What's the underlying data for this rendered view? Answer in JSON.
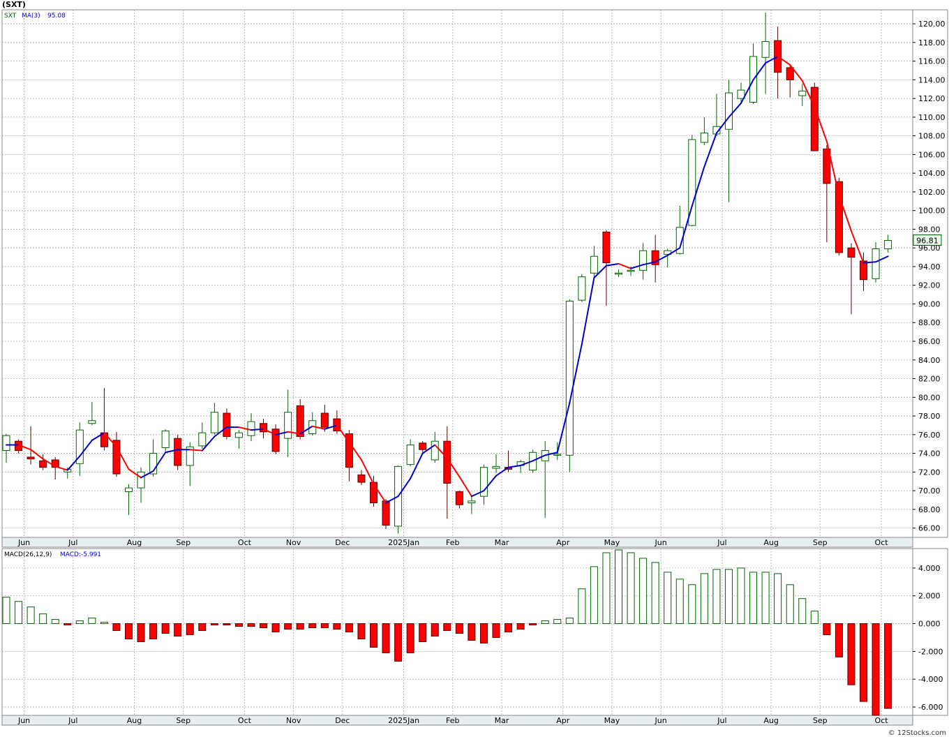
{
  "title": "(SXT)",
  "credit": "© 12Stocks.com",
  "colors": {
    "up": "#006400",
    "down": "#ff0000",
    "ma_up": "#0000cc",
    "ma_down": "#ff0000",
    "grid": "#aaaaaa",
    "axis_bg": "#e6eef2"
  },
  "price_panel": {
    "legend_symbol": "SXT",
    "legend_ma": "MA(3)",
    "legend_ma_value": "95.08",
    "last_price_label": "96.81"
  },
  "macd_panel": {
    "legend_name": "MACD(26,12,9)",
    "legend_value": "MACD:-5.991"
  },
  "month_labels": [
    {
      "label": "Jun",
      "i": 1
    },
    {
      "label": "Jul",
      "i": 5
    },
    {
      "label": "Aug",
      "i": 10
    },
    {
      "label": "Sep",
      "i": 14
    },
    {
      "label": "Oct",
      "i": 19
    },
    {
      "label": "Nov",
      "i": 23
    },
    {
      "label": "Dec",
      "i": 27
    },
    {
      "label": "2025Jan",
      "i": 32
    },
    {
      "label": "Feb",
      "i": 36
    },
    {
      "label": "Mar",
      "i": 40
    },
    {
      "label": "Apr",
      "i": 45
    },
    {
      "label": "May",
      "i": 49
    },
    {
      "label": "Jun",
      "i": 53
    },
    {
      "label": "Jul",
      "i": 58
    },
    {
      "label": "Aug",
      "i": 62
    },
    {
      "label": "Sep",
      "i": 66
    },
    {
      "label": "Oct",
      "i": 71
    }
  ],
  "chart_data": [
    {
      "type": "candlestick",
      "title": "(SXT)",
      "ylim": [
        65,
        121.5
      ],
      "yticks": [
        "66.00",
        "68.00",
        "70.00",
        "72.00",
        "74.00",
        "76.00",
        "78.00",
        "80.00",
        "82.00",
        "84.00",
        "86.00",
        "88.00",
        "90.00",
        "92.00",
        "94.00",
        "96.00",
        "98.00",
        "100.00",
        "102.00",
        "104.00",
        "106.00",
        "108.00",
        "110.00",
        "112.00",
        "114.00",
        "116.00",
        "118.00",
        "120.00"
      ],
      "candles": [
        [
          74.3,
          75.9,
          73.0,
          76.1
        ],
        [
          75.3,
          74.3,
          74.0,
          75.5
        ],
        [
          73.6,
          73.4,
          72.8,
          76.9
        ],
        [
          73.2,
          72.5,
          72.2,
          73.9
        ],
        [
          73.3,
          72.5,
          71.2,
          73.6
        ],
        [
          72.0,
          72.3,
          71.3,
          72.5
        ],
        [
          72.9,
          76.5,
          71.6,
          77.3
        ],
        [
          77.2,
          77.5,
          77.0,
          79.5
        ],
        [
          76.2,
          74.7,
          74.3,
          81.0
        ],
        [
          75.4,
          71.8,
          71.5,
          76.3
        ],
        [
          69.9,
          70.3,
          67.4,
          70.7
        ],
        [
          70.3,
          72.0,
          68.7,
          72.5
        ],
        [
          71.8,
          74.0,
          71.5,
          75.5
        ],
        [
          74.6,
          76.4,
          74.2,
          76.6
        ],
        [
          75.6,
          72.7,
          72.2,
          76.0
        ],
        [
          72.7,
          74.7,
          70.5,
          75.2
        ],
        [
          74.8,
          76.2,
          74.5,
          77.3
        ],
        [
          76.2,
          78.4,
          76.0,
          79.4
        ],
        [
          78.3,
          75.8,
          75.5,
          78.8
        ],
        [
          75.7,
          76.2,
          74.5,
          76.5
        ],
        [
          75.9,
          77.4,
          75.3,
          78.3
        ],
        [
          77.2,
          76.3,
          75.6,
          77.7
        ],
        [
          76.6,
          74.2,
          73.9,
          77.1
        ],
        [
          75.6,
          78.4,
          73.6,
          80.8
        ],
        [
          79.1,
          75.8,
          75.5,
          79.8
        ],
        [
          76.1,
          77.5,
          75.9,
          78.4
        ],
        [
          78.3,
          76.8,
          76.3,
          79.2
        ],
        [
          77.7,
          76.4,
          76.1,
          78.6
        ],
        [
          76.1,
          72.5,
          71.0,
          76.5
        ],
        [
          71.7,
          70.9,
          70.6,
          72.2
        ],
        [
          70.9,
          68.7,
          68.3,
          71.6
        ],
        [
          68.9,
          66.3,
          65.9,
          69.1
        ],
        [
          66.2,
          72.6,
          65.4,
          72.7
        ],
        [
          72.8,
          74.9,
          72.6,
          75.5
        ],
        [
          75.1,
          74.4,
          74.0,
          75.3
        ],
        [
          73.3,
          75.3,
          73.0,
          76.3
        ],
        [
          75.3,
          70.8,
          67.0,
          76.9
        ],
        [
          69.9,
          68.5,
          68.1,
          70.0
        ],
        [
          68.7,
          68.9,
          67.5,
          69.4
        ],
        [
          69.4,
          72.5,
          68.5,
          72.8
        ],
        [
          72.4,
          72.6,
          71.9,
          73.9
        ],
        [
          72.5,
          72.3,
          72.0,
          74.3
        ],
        [
          72.7,
          73.1,
          71.9,
          73.3
        ],
        [
          72.2,
          74.1,
          71.9,
          74.4
        ],
        [
          73.2,
          74.3,
          67.1,
          75.3
        ],
        [
          73.9,
          73.9,
          73.3,
          75.2
        ],
        [
          73.8,
          90.3,
          72.0,
          90.5
        ],
        [
          90.4,
          92.9,
          90.2,
          93.2
        ],
        [
          93.3,
          95.1,
          92.9,
          96.2
        ],
        [
          97.7,
          94.4,
          89.8,
          97.9
        ],
        [
          93.2,
          93.3,
          92.9,
          93.7
        ],
        [
          93.5,
          93.6,
          93.0,
          94.0
        ],
        [
          93.6,
          95.7,
          92.6,
          96.5
        ],
        [
          95.7,
          94.2,
          92.3,
          97.4
        ],
        [
          95.3,
          95.7,
          93.9,
          95.9
        ],
        [
          95.4,
          98.2,
          95.3,
          100.5
        ],
        [
          98.4,
          107.6,
          98.3,
          108.1
        ],
        [
          107.3,
          108.3,
          107.0,
          110.0
        ],
        [
          108.2,
          109.0,
          108.0,
          112.5
        ],
        [
          108.7,
          112.6,
          100.9,
          114.0
        ],
        [
          112.0,
          112.9,
          111.6,
          113.7
        ],
        [
          111.6,
          116.5,
          111.4,
          117.9
        ],
        [
          116.4,
          118.1,
          112.5,
          121.2
        ],
        [
          118.2,
          114.8,
          112.0,
          119.7
        ],
        [
          115.3,
          114.0,
          112.1,
          115.6
        ],
        [
          112.3,
          112.8,
          111.2,
          113.6
        ],
        [
          113.2,
          106.4,
          106.4,
          113.7
        ],
        [
          106.6,
          102.9,
          96.6,
          107.0
        ],
        [
          103.1,
          95.5,
          95.2,
          103.5
        ],
        [
          96.0,
          95.0,
          88.9,
          96.5
        ],
        [
          94.6,
          92.6,
          91.4,
          95.5
        ],
        [
          92.7,
          95.9,
          92.3,
          96.6
        ],
        [
          95.9,
          96.8,
          95.5,
          97.4
        ]
      ],
      "ma": [
        74.9,
        74.9,
        74.4,
        73.4,
        72.6,
        72.2,
        73.7,
        75.4,
        76.2,
        74.7,
        72.3,
        71.4,
        72.1,
        74.1,
        74.4,
        74.4,
        74.3,
        75.8,
        76.8,
        76.8,
        76.5,
        76.6,
        76.0,
        76.3,
        76.1,
        76.9,
        76.6,
        77.0,
        75.2,
        73.3,
        70.7,
        68.7,
        69.4,
        71.3,
        74.0,
        74.9,
        73.5,
        71.5,
        69.4,
        70.0,
        71.6,
        72.5,
        72.7,
        73.2,
        73.8,
        74.1,
        79.4,
        85.7,
        92.8,
        94.1,
        94.3,
        93.8,
        94.2,
        94.5,
        95.2,
        96.0,
        100.5,
        104.7,
        108.3,
        110.0,
        111.5,
        114.0,
        115.8,
        116.5,
        115.6,
        113.9,
        111.1,
        107.4,
        101.6,
        97.8,
        94.4,
        94.5,
        95.1
      ],
      "ma_series_name": "MA(3)"
    },
    {
      "type": "bar",
      "title": "MACD(26,12,9)",
      "series_name": "MACD",
      "ylim": [
        -6.6,
        5.4
      ],
      "yticks": [
        "-6.000",
        "-4.000",
        "-2.000",
        "0.000",
        "2.000",
        "4.000"
      ],
      "values": [
        1.9,
        1.6,
        1.2,
        0.7,
        0.3,
        -0.1,
        0.2,
        0.4,
        0.1,
        -0.5,
        -1.1,
        -1.3,
        -1.1,
        -0.7,
        -0.9,
        -0.8,
        -0.5,
        -0.1,
        -0.1,
        -0.2,
        -0.2,
        -0.3,
        -0.6,
        -0.4,
        -0.4,
        -0.3,
        -0.3,
        -0.4,
        -0.6,
        -1.1,
        -1.7,
        -2.1,
        -2.7,
        -2.1,
        -1.3,
        -0.9,
        -0.5,
        -0.7,
        -1.2,
        -1.4,
        -1.0,
        -0.6,
        -0.4,
        -0.1,
        0.2,
        0.3,
        0.4,
        2.5,
        4.1,
        5.1,
        5.3,
        5.1,
        4.7,
        4.4,
        3.7,
        3.2,
        2.8,
        3.6,
        3.9,
        3.9,
        4.0,
        3.7,
        3.7,
        3.6,
        2.8,
        1.8,
        0.9,
        -0.8,
        -2.4,
        -4.4,
        -5.6,
        -6.6,
        -6.1
      ]
    }
  ]
}
